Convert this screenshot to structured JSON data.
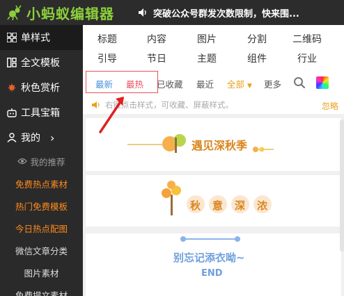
{
  "header": {
    "logo_text": "小蚂蚁编辑器",
    "notice": "突破公众号群发次数限制，快来围..."
  },
  "sidebar": {
    "items": [
      {
        "label": "单样式"
      },
      {
        "label": "全文模板"
      },
      {
        "label": "秋色赏析"
      },
      {
        "label": "工具宝箱"
      },
      {
        "label": "我的"
      }
    ],
    "sub_items": [
      {
        "label": "我的推荐"
      },
      {
        "label": "免费热点素材"
      },
      {
        "label": "热门免费模板"
      },
      {
        "label": "今日热点配图"
      },
      {
        "label": "微信文章分类"
      },
      {
        "label": "图片素材"
      },
      {
        "label": "免费提文素材"
      }
    ]
  },
  "categories": [
    [
      "标题",
      "内容",
      "图片",
      "分割",
      "二维码"
    ],
    [
      "引导",
      "节日",
      "主题",
      "组件",
      "行业"
    ]
  ],
  "filters": {
    "newest": "最新",
    "hottest": "最热",
    "favorites": "已收藏",
    "recent": "最近",
    "all": "全部",
    "more": "更多"
  },
  "tip": {
    "text": "右键点击样式，可收藏、屏蔽样式。",
    "ignore": "忽略"
  },
  "cards": {
    "card1_title": "遇见深秋季",
    "card2_chars": [
      "秋",
      "意",
      "深",
      "浓"
    ],
    "card3_title": "别忘记添衣呦~",
    "card3_sub": "END"
  }
}
